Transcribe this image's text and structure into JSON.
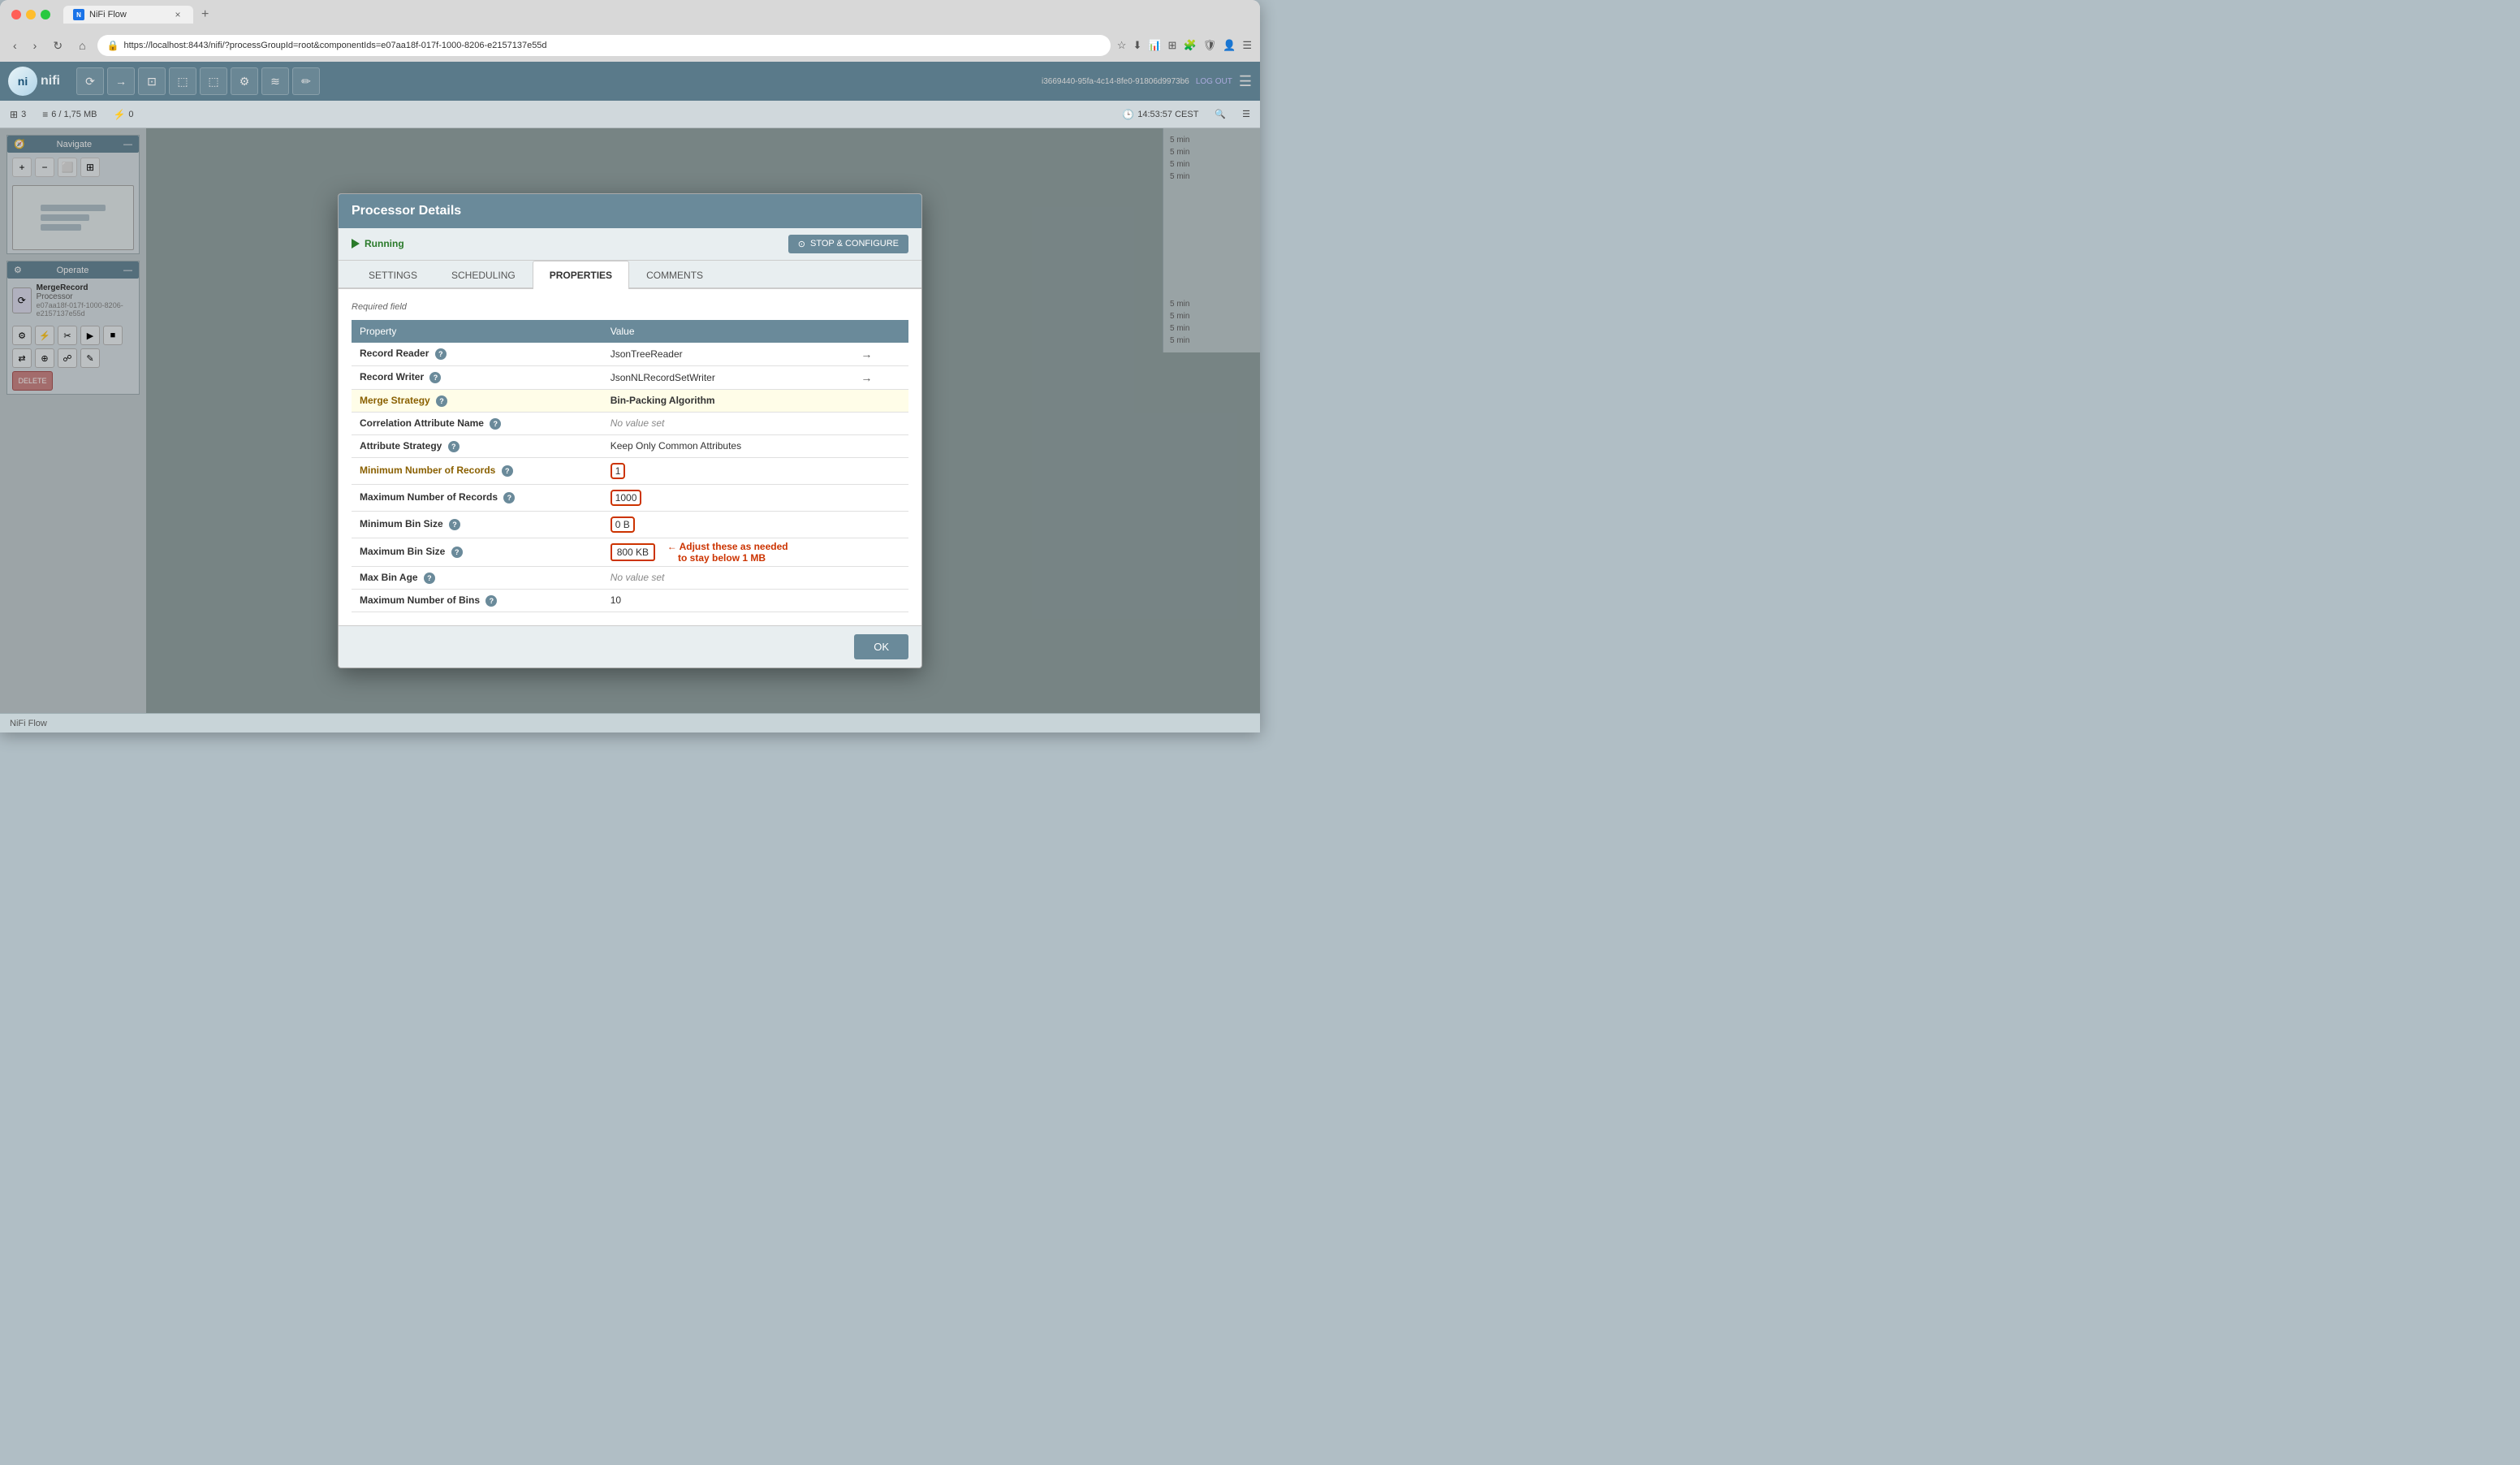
{
  "browser": {
    "tab_title": "NiFi Flow",
    "tab_favicon": "N",
    "address_url": "https://localhost:8443/nifi/?processGroupId=root&componentIds=e07aa18f-017f-1000-8206-e2157137e55d",
    "new_tab_label": "+",
    "close_tab_label": "×"
  },
  "nifi": {
    "logo_text": "nifi",
    "user_id": "i3669440-95fa-4c14-8fe0-91806d9973b6",
    "logout_label": "LOG OUT",
    "status_bar": {
      "threads": "3",
      "queue_label": "6 / 1,75 MB",
      "queue_icon": "≡",
      "errors": "0",
      "time": "14:53:57 CEST"
    },
    "toolbar_icons": [
      "⟳",
      "→",
      "≡",
      "⬜",
      "⬚",
      "⚙",
      "≋",
      "✏"
    ],
    "bottom_bar_label": "NiFi Flow"
  },
  "navigate_panel": {
    "title": "Navigate",
    "controls": [
      "+",
      "-",
      "⬜",
      "⊞"
    ]
  },
  "operate_panel": {
    "title": "Operate",
    "component_name": "MergeRecord",
    "component_type": "Processor",
    "component_id": "e07aa18f-017f-1000-8206-e2157137e55d",
    "buttons": [
      "⚙",
      "⚡",
      "✂",
      "▶",
      "■",
      "⇄",
      "⊕",
      "☍",
      "✎",
      "DELETE"
    ]
  },
  "dialog": {
    "title": "Processor Details",
    "status": "Running",
    "stop_configure_label": "STOP & CONFIGURE",
    "tabs": [
      {
        "id": "settings",
        "label": "SETTINGS",
        "active": false
      },
      {
        "id": "scheduling",
        "label": "SCHEDULING",
        "active": false
      },
      {
        "id": "properties",
        "label": "PROPERTIES",
        "active": true
      },
      {
        "id": "comments",
        "label": "COMMENTS",
        "active": false
      }
    ],
    "required_field_label": "Required field",
    "table": {
      "headers": [
        "Property",
        "Value"
      ],
      "rows": [
        {
          "property": "Record Reader",
          "required": false,
          "has_help": true,
          "value": "JsonTreeReader",
          "has_arrow": true,
          "highlighted": false
        },
        {
          "property": "Record Writer",
          "required": false,
          "has_help": true,
          "value": "JsonNLRecordSetWriter",
          "has_arrow": true,
          "highlighted": false
        },
        {
          "property": "Merge Strategy",
          "required": true,
          "has_help": true,
          "value": "Bin-Packing Algorithm",
          "has_arrow": false,
          "highlighted": true
        },
        {
          "property": "Correlation Attribute Name",
          "required": false,
          "has_help": true,
          "value": "No value set",
          "has_arrow": false,
          "highlighted": false
        },
        {
          "property": "Attribute Strategy",
          "required": false,
          "has_help": true,
          "value": "Keep Only Common Attributes",
          "has_arrow": false,
          "highlighted": false
        },
        {
          "property": "Minimum Number of Records",
          "required": true,
          "has_help": true,
          "value": "1",
          "has_arrow": false,
          "highlighted": false,
          "boxed": true
        },
        {
          "property": "Maximum Number of Records",
          "required": false,
          "has_help": true,
          "value": "1000",
          "has_arrow": false,
          "highlighted": false,
          "boxed": true
        },
        {
          "property": "Minimum Bin Size",
          "required": false,
          "has_help": true,
          "value": "0 B",
          "has_arrow": false,
          "highlighted": false,
          "boxed": true
        },
        {
          "property": "Maximum Bin Size",
          "required": false,
          "has_help": true,
          "value": "800 KB",
          "has_arrow": false,
          "highlighted": false,
          "boxed": true
        },
        {
          "property": "Max Bin Age",
          "required": false,
          "has_help": true,
          "value": "No value set",
          "has_arrow": false,
          "highlighted": false
        },
        {
          "property": "Maximum Number of Bins",
          "required": false,
          "has_help": true,
          "value": "10",
          "has_arrow": false,
          "highlighted": false
        }
      ]
    },
    "annotation": {
      "text": "Adjust these as needed\nto stay below 1 MB",
      "arrow": "←"
    },
    "ok_button_label": "OK"
  },
  "right_panel": {
    "items": [
      "5 min",
      "5 min",
      "5 min",
      "5 min",
      "5 min",
      "5 min",
      "5 min",
      "5 min"
    ]
  }
}
